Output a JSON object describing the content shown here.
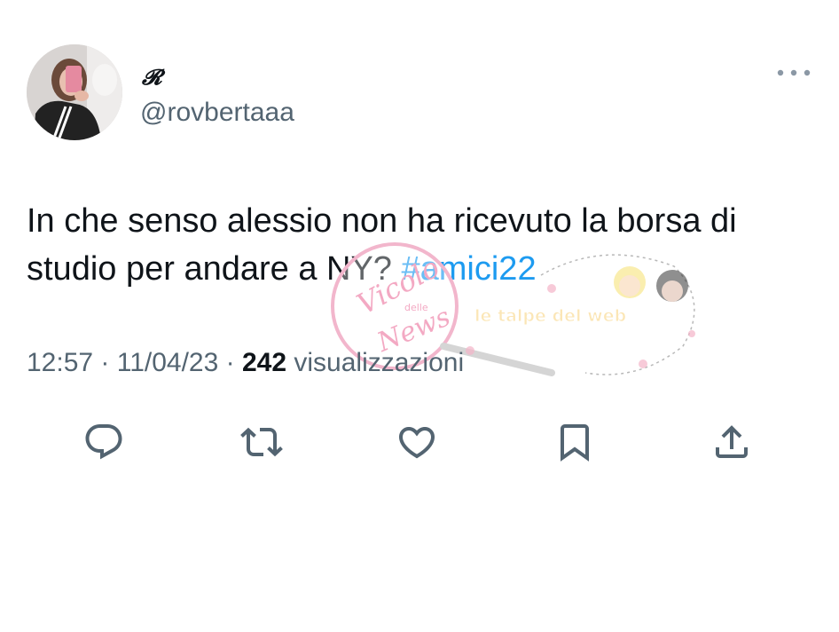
{
  "user": {
    "display_name": "𝓡",
    "handle": "@rovbertaaa"
  },
  "tweet": {
    "text": "In che senso alessio non ha ricevuto la borsa di studio per andare a NY? ",
    "hashtag": "#amici22"
  },
  "meta": {
    "time": "12:57",
    "separator": " · ",
    "date": "11/04/23",
    "views_count": "242",
    "views_label": " visualizzazioni"
  },
  "watermark": {
    "logo_line1": "Vicolo",
    "logo_line2": "delle",
    "logo_line3": "News",
    "banner": "le talpe del web"
  },
  "icons": {
    "more": "more-dots-icon",
    "reply": "reply-icon",
    "retweet": "retweet-icon",
    "like": "heart-icon",
    "bookmark": "bookmark-icon",
    "share": "share-icon"
  },
  "colors": {
    "text": "#0f1419",
    "secondary": "#536471",
    "link": "#1d9bf0"
  }
}
